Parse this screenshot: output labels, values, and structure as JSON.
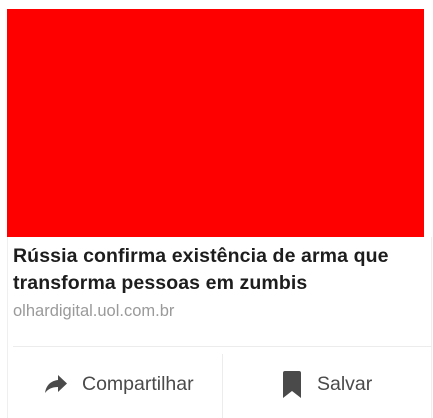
{
  "card": {
    "image_color": "#ff0000",
    "headline": "Rússia confirma existência de arma que transforma pessoas em zumbis",
    "domain": "olhardigital.uol.com.br"
  },
  "actions": {
    "share": {
      "label": "Compartilhar",
      "icon": "share-arrow-icon"
    },
    "save": {
      "label": "Salvar",
      "icon": "bookmark-icon"
    }
  },
  "colors": {
    "headline_text": "#1d1d1d",
    "domain_text": "#9a9a9a",
    "action_text": "#4a4a4a",
    "icon": "#4a4a4a"
  }
}
